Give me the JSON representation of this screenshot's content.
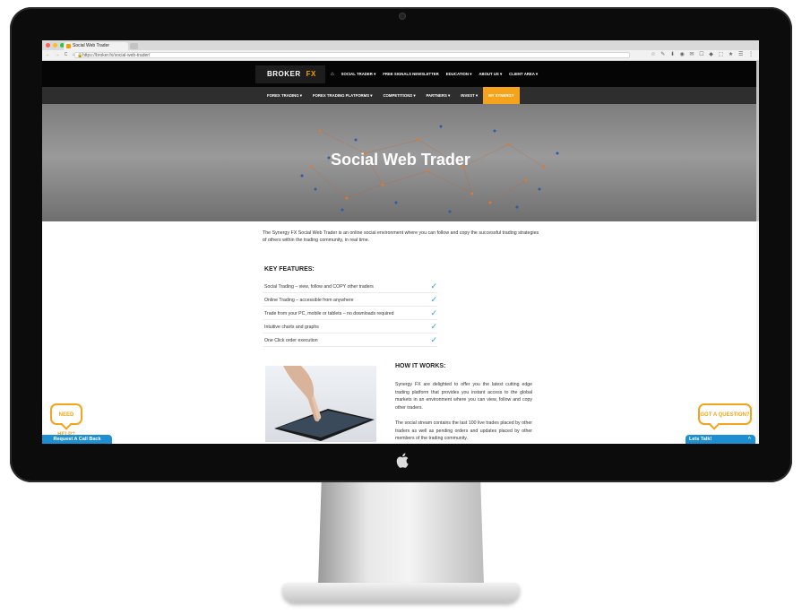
{
  "browser": {
    "tab_title": "Social Web Trader",
    "url": "https://broker.fx/social-web-trader/",
    "nav_glyphs": "← → C ⌂",
    "extension_glyphs": "☆ ✎ ⬇ ◉ ✉ ☐ ◆ ⬚ ★ ☰ ⋮"
  },
  "site": {
    "logo_broker": "BROKER",
    "logo_fx": "FX",
    "top_menu": [
      "SOCIAL TRADER ▾",
      "FREE SIGNALS NEWSLETTER",
      "EDUCATION ▾",
      "ABOUT US ▾",
      "CLIENT AREA ▾"
    ],
    "home_icon": "home-icon",
    "sub_menu": [
      "FOREX TRADING ▾",
      "FOREX TRADING PLATFORMS ▾",
      "COMPETITIONS ▾",
      "PARTNERS ▾",
      "INVEST ▾",
      "MY SYNERGY"
    ],
    "accent_color": "#f5a31a"
  },
  "hero": {
    "title": "Social Web Trader"
  },
  "intro": "The Synergy FX Social Web Trader is an online social environment where you can follow and copy the successful trading strategies of others within the trading community, in real time.",
  "key_features": {
    "title": "KEY FEATURES:",
    "items": [
      "Social Trading – view, follow and COPY other traders",
      "Online Trading – accessible from anywhere",
      "Trade from your PC, mobile or tablets – no downloads required",
      "Intuitive charts and graphs",
      "One Click order execution"
    ],
    "check_glyph": "✓"
  },
  "how_it_works": {
    "title": "HOW IT WORKS:",
    "p1": "Synergy FX are delighted to offer you the latest cutting edge trading platform that provides you instant access to the global markets in an environment where you can view, follow and copy other traders.",
    "p2": "The social stream contains the last 100 live trades placed by other traders as well as pending orders and updates placed by other members of the trading community."
  },
  "widgets": {
    "need_help": "NEED HELP?",
    "callback": "Request A Call Back",
    "got_question": "GOT A QUESTION?",
    "lets_talk": "Lets Talk!",
    "chevron": "^"
  }
}
